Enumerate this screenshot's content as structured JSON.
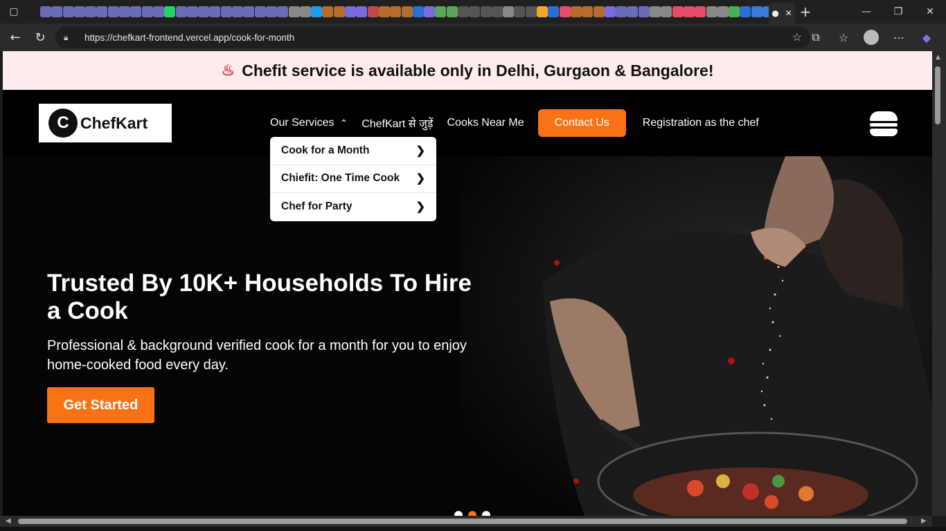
{
  "browser": {
    "url": "https://chefkart-frontend.vercel.app/cook-for-month",
    "tab_close": "✕",
    "new_tab": "+",
    "favicon_colors": [
      "#6b6bb8",
      "#6b6bb8",
      "#6b6bb8",
      "#6b6bb8",
      "#6b6bb8",
      "#6b6bb8",
      "#6b6bb8",
      "#6b6bb8",
      "#6b6bb8",
      "#6b6bb8",
      "#6b6bb8",
      "#25d366",
      "#6b6bb8",
      "#6b6bb8",
      "#6b6bb8",
      "#6b6bb8",
      "#6b6bb8",
      "#6b6bb8",
      "#6b6bb8",
      "#6b6bb8",
      "#6b6bb8",
      "#6b6bb8",
      "#888",
      "#888",
      "#1d9bf0",
      "#b56c2c",
      "#b56c2c",
      "#7a6be0",
      "#7a6be0",
      "#c04a4a",
      "#b56c2c",
      "#b56c2c",
      "#b56c2c",
      "#2a6fd6",
      "#7a6be0",
      "#5aa55a",
      "#5aa55a",
      "#555",
      "#555",
      "#555",
      "#555",
      "#888",
      "#555",
      "#555",
      "#f5a623",
      "#2a6fd6",
      "#e94b6b",
      "#b56c2c",
      "#b56c2c",
      "#b56c2c",
      "#7a6be0",
      "#6b6bb8",
      "#6b6bb8",
      "#6b6bb8",
      "#888",
      "#888",
      "#e94b6b",
      "#e94b6b",
      "#e94b6b",
      "#888",
      "#888",
      "#4caf50",
      "#2a6fd6",
      "#3b7bdb",
      "#3b7bdb",
      "#888",
      "#fff"
    ]
  },
  "banner": {
    "text": "Chefit service is available only in Delhi, Gurgaon & Bangalore!"
  },
  "logo": {
    "mark": "C",
    "text": "ChefKart"
  },
  "nav": {
    "services": "Our Services",
    "join": "ChefKart से जुड़ें",
    "cooks_near": "Cooks Near Me",
    "contact": "Contact Us",
    "registration": "Registration as the chef"
  },
  "dropdown": {
    "items": [
      {
        "label": "Cook for a Month"
      },
      {
        "label": "Chiefit: One Time Cook"
      },
      {
        "label": "Chef for Party"
      }
    ]
  },
  "hero": {
    "heading": "Trusted By 10K+ Households To Hire a Cook",
    "subheading": "Professional & background verified cook for a month for you to enjoy home-cooked food every day.",
    "cta": "Get Started",
    "carousel_count": 3,
    "carousel_active": 2
  },
  "colors": {
    "accent": "#f97316",
    "banner_bg": "#fdeceb",
    "banner_icon": "#e8324a"
  }
}
